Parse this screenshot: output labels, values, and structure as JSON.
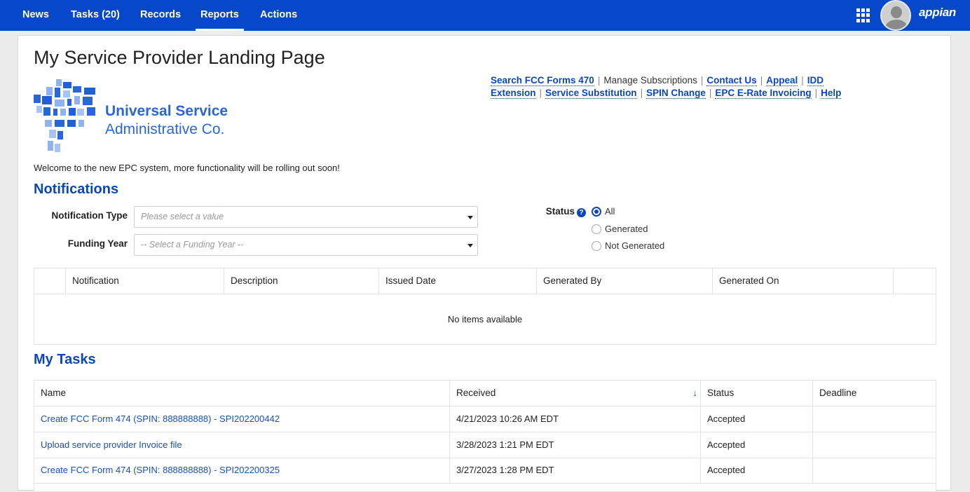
{
  "nav": {
    "items": [
      {
        "label": "News"
      },
      {
        "label": "Tasks (20)"
      },
      {
        "label": "Records"
      },
      {
        "label": "Reports"
      },
      {
        "label": "Actions"
      }
    ],
    "active": "Reports",
    "brand": "appian",
    "accent": "#0747c9"
  },
  "page": {
    "title": "My Service Provider Landing Page",
    "logo": {
      "line1": "Universal Service",
      "line2": "Administrative Co."
    },
    "welcome": "Welcome to the new EPC system, more functionality will be rolling out soon!"
  },
  "links": [
    {
      "label": "Search FCC Forms 470",
      "link": true
    },
    {
      "label": "Manage Subscriptions",
      "link": false
    },
    {
      "label": "Contact Us",
      "link": true
    },
    {
      "label": "Appeal",
      "link": true
    },
    {
      "label": "IDD Extension",
      "link": true
    },
    {
      "label": "Service Substitution",
      "link": true
    },
    {
      "label": "SPIN Change",
      "link": true
    },
    {
      "label": "EPC E-Rate Invoicing",
      "link": true
    },
    {
      "label": "Help",
      "link": true
    }
  ],
  "notifications": {
    "title": "Notifications",
    "notification_type_label": "Notification Type",
    "notification_type_placeholder": "Please select a value",
    "funding_year_label": "Funding Year",
    "funding_year_placeholder": "-- Select a Funding Year --",
    "status_label": "Status",
    "status_options": [
      "All",
      "Generated",
      "Not Generated"
    ],
    "status_selected": "All",
    "columns": [
      "",
      "Notification",
      "Description",
      "Issued Date",
      "Generated By",
      "Generated On",
      ""
    ],
    "empty_text": "No items available"
  },
  "tasks": {
    "title": "My Tasks",
    "columns": [
      "Name",
      "Received",
      "Status",
      "Deadline"
    ],
    "sort_icon": "arrow-down-icon",
    "rows": [
      {
        "name": "Create FCC Form 474 (SPIN: 888888888) - SPI202200442",
        "received": "4/21/2023 10:26 AM EDT",
        "status": "Accepted",
        "deadline": ""
      },
      {
        "name": "Upload service provider Invoice file",
        "received": "3/28/2023 1:21 PM EDT",
        "status": "Accepted",
        "deadline": ""
      },
      {
        "name": "Create FCC Form 474 (SPIN: 888888888) - SPI202200325",
        "received": "3/27/2023 1:28 PM EDT",
        "status": "Accepted",
        "deadline": ""
      }
    ]
  }
}
